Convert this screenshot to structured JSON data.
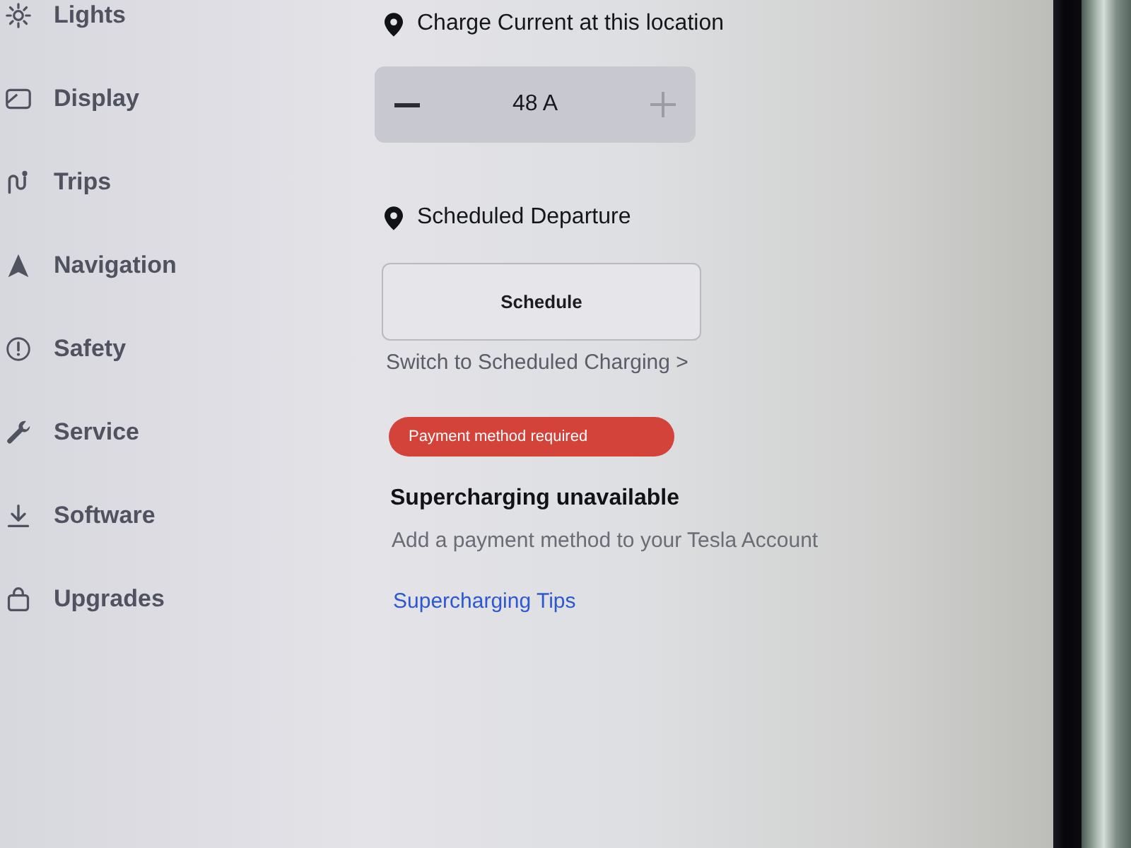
{
  "sidebar": {
    "items": [
      {
        "label": "Lights",
        "selected": false
      },
      {
        "label": "Display",
        "selected": false
      },
      {
        "label": "Trips",
        "selected": false
      },
      {
        "label": "Navigation",
        "selected": false
      },
      {
        "label": "Safety",
        "selected": false
      },
      {
        "label": "Service",
        "selected": false
      },
      {
        "label": "Software",
        "selected": false
      },
      {
        "label": "Upgrades",
        "selected": false
      }
    ]
  },
  "charge_current": {
    "title": "Charge Current at this location",
    "value": "48 A",
    "decrease": {
      "disabled": false
    },
    "increase": {
      "disabled": true
    }
  },
  "scheduled_departure": {
    "title": "Scheduled Departure",
    "button": "Schedule",
    "link": "Switch to Scheduled Charging >"
  },
  "supercharging": {
    "badge": "Payment method required",
    "title": "Supercharging unavailable",
    "message": "Add a payment method to your Tesla Account",
    "link": "Supercharging Tips"
  }
}
